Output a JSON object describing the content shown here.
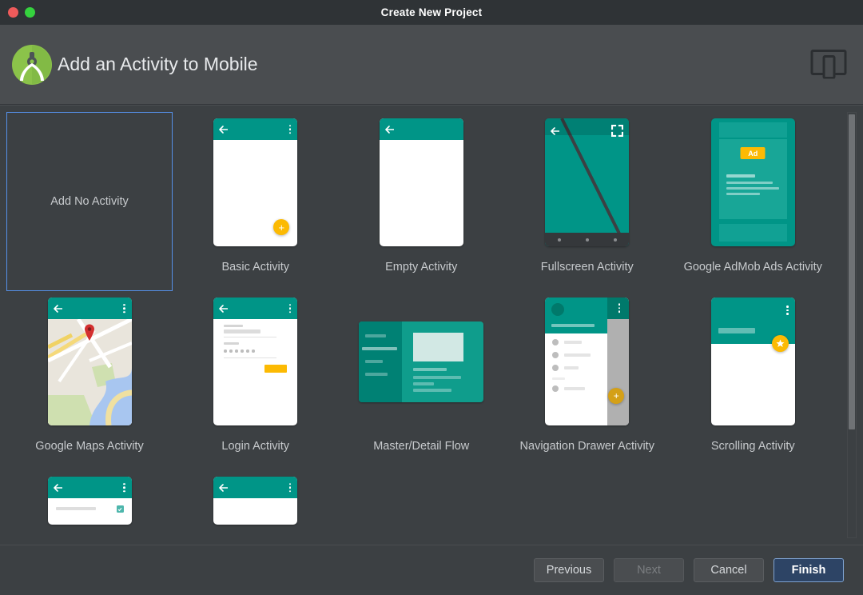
{
  "window": {
    "title": "Create New Project",
    "close_icon": "close-traffic-light",
    "maximize_icon": "maximize-traffic-light"
  },
  "header": {
    "logo_icon": "android-studio-logo",
    "title": "Add an Activity to Mobile",
    "device_icon": "tablet-and-phone-icon"
  },
  "colors": {
    "accent_teal": "#009587",
    "accent_amber": "#fcba03",
    "selection_blue": "#5590e8",
    "primary_button": "#2d4465",
    "window_bg": "#3c4043",
    "header_bg": "#4a4d50"
  },
  "gallery": {
    "selected_index": 0,
    "scrollbar": {
      "name": "gallery-scrollbar",
      "thumb_position_percent": 0
    },
    "items": [
      {
        "id": "no-activity",
        "label": "Add No Activity",
        "thumb": "none",
        "selected": true
      },
      {
        "id": "basic-activity",
        "label": "Basic Activity",
        "thumb": "phone-fab-plus",
        "selected": false
      },
      {
        "id": "empty-activity",
        "label": "Empty Activity",
        "thumb": "phone-empty",
        "selected": false
      },
      {
        "id": "fullscreen-activity",
        "label": "Fullscreen Activity",
        "thumb": "phone-fullscreen",
        "selected": false
      },
      {
        "id": "admob-activity",
        "label": "Google AdMob Ads Activity",
        "thumb": "phone-admob",
        "selected": false,
        "badge_text": "Ad"
      },
      {
        "id": "maps-activity",
        "label": "Google Maps Activity",
        "thumb": "phone-map",
        "selected": false
      },
      {
        "id": "login-activity",
        "label": "Login Activity",
        "thumb": "phone-login",
        "selected": false
      },
      {
        "id": "master-detail-flow",
        "label": "Master/Detail Flow",
        "thumb": "tablet-master-detail",
        "selected": false
      },
      {
        "id": "nav-drawer-activity",
        "label": "Navigation Drawer Activity",
        "thumb": "phone-nav-drawer",
        "selected": false
      },
      {
        "id": "scrolling-activity",
        "label": "Scrolling Activity",
        "thumb": "phone-scrolling",
        "selected": false
      },
      {
        "id": "settings-activity",
        "label": "",
        "thumb": "phone-checkbox-partial",
        "selected": false
      },
      {
        "id": "tabbed-activity",
        "label": "",
        "thumb": "phone-plain-partial",
        "selected": false
      }
    ]
  },
  "footer": {
    "buttons": [
      {
        "id": "previous",
        "label": "Previous",
        "state": "enabled"
      },
      {
        "id": "next",
        "label": "Next",
        "state": "disabled"
      },
      {
        "id": "cancel",
        "label": "Cancel",
        "state": "enabled"
      },
      {
        "id": "finish",
        "label": "Finish",
        "state": "primary"
      }
    ]
  }
}
